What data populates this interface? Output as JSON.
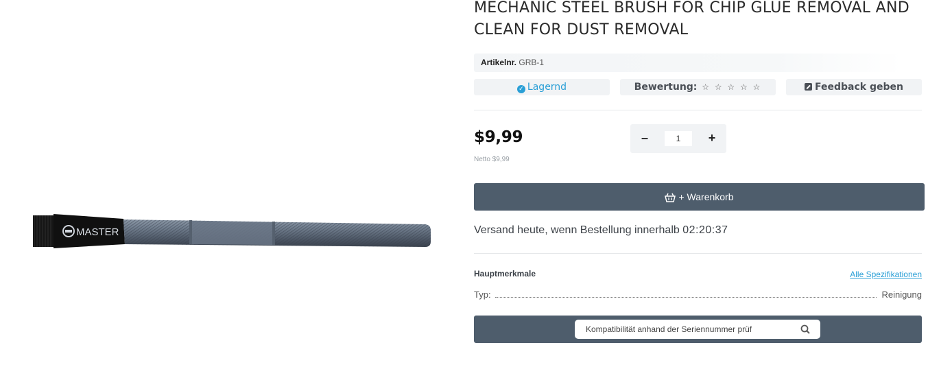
{
  "product": {
    "title": "MECHANIC STEEL BRUSH FOR CHIP GLUE REMOVAL AND CLEAN FOR DUST REMOVAL",
    "image_brand_text": "MASTER",
    "sku_label": "Artikelnr.",
    "sku_value": "GRB-1"
  },
  "status": {
    "stock_label": "Lagernd",
    "rating_label": "Bewertung:",
    "rating_stars": "☆ ☆ ☆ ☆ ☆",
    "rating_value": 0,
    "rating_max": 5,
    "feedback_label": "Feedback geben"
  },
  "pricing": {
    "price": "$9,99",
    "netto": "Netto $9,99"
  },
  "quantity": {
    "minus": "–",
    "value": "1",
    "plus": "+"
  },
  "cart": {
    "label": "+ Warenkorb"
  },
  "shipping": {
    "text": "Versand heute, wenn Bestellung innerhalb",
    "timer": "02:20:37"
  },
  "features": {
    "title": "Hauptmerkmale",
    "all_specs_link": "Alle Spezifikationen",
    "rows": [
      {
        "key": "Typ:",
        "value": "Reinigung"
      }
    ]
  },
  "compatibility": {
    "placeholder": "Kompatibilität anhand der Seriennummer prüf"
  },
  "colors": {
    "accent": "#2a9fd6",
    "button_bg": "#4e5d6c",
    "chip_bg": "#f1f3f5"
  }
}
